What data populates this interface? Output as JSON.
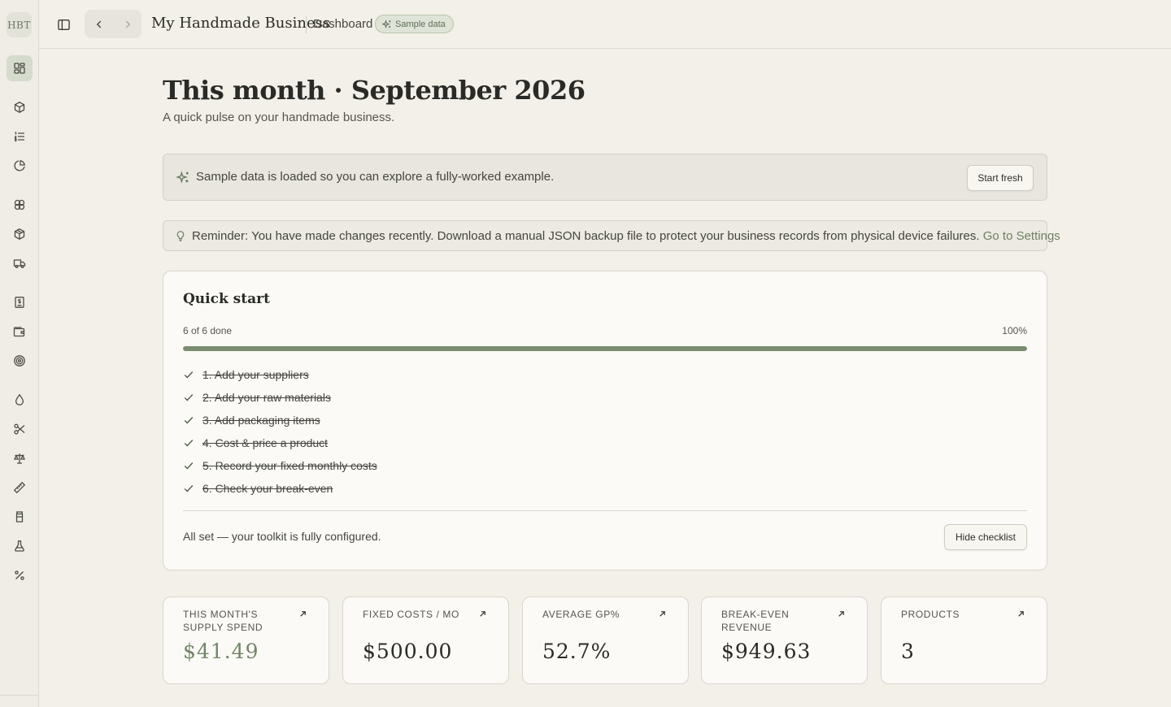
{
  "app": {
    "logo_text": "HBT",
    "business_name": "My Handmade Business",
    "breadcrumb": "Dashboard",
    "badge": "Sample data"
  },
  "sidebar": {
    "items": [
      {
        "icon": "dashboard-icon",
        "active": true
      },
      {
        "icon": "product-box-icon",
        "active": false
      },
      {
        "icon": "list-icon",
        "active": false
      },
      {
        "icon": "pie-chart-icon",
        "active": false
      },
      {
        "icon": "materials-icon",
        "active": false
      },
      {
        "icon": "packaging-box-icon",
        "active": false
      },
      {
        "icon": "truck-icon",
        "active": false
      },
      {
        "icon": "receipt-icon",
        "active": false
      },
      {
        "icon": "wallet-icon",
        "active": false
      },
      {
        "icon": "target-icon",
        "active": false
      },
      {
        "icon": "droplet-icon",
        "active": false
      },
      {
        "icon": "scissors-icon",
        "active": false
      },
      {
        "icon": "scale-icon",
        "active": false
      },
      {
        "icon": "ruler-icon",
        "active": false
      },
      {
        "icon": "jar-icon",
        "active": false
      },
      {
        "icon": "flask-icon",
        "active": false
      },
      {
        "icon": "percent-icon",
        "active": false
      }
    ]
  },
  "page": {
    "title": "This month · September 2026",
    "subtitle": "A quick pulse on your handmade business."
  },
  "sample_banner": {
    "text": "Sample data is loaded so you can explore a fully-worked example.",
    "button": "Start fresh"
  },
  "reminder": {
    "text": "Reminder: You have made changes recently. Download a manual JSON backup file to protect your business records from physical device failures.",
    "link": "Go to Settings"
  },
  "quick_start": {
    "title": "Quick start",
    "progress_label": "6 of 6 done",
    "progress_pct_label": "100%",
    "progress_fraction": 1.0,
    "steps": [
      "1. Add your suppliers",
      "2. Add your raw materials",
      "3. Add packaging items",
      "4. Cost & price a product",
      "5. Record your fixed monthly costs",
      "6. Check your break-even"
    ],
    "done_text": "All set — your toolkit is fully configured.",
    "hide_button": "Hide checklist"
  },
  "stats": [
    {
      "label": "This month's supply spend",
      "value": "$41.49",
      "accent": true
    },
    {
      "label": "Fixed costs / mo",
      "value": "$500.00",
      "accent": false
    },
    {
      "label": "Average GP%",
      "value": "52.7%",
      "accent": false
    },
    {
      "label": "Break-even revenue",
      "value": "$949.63",
      "accent": false
    },
    {
      "label": "Products",
      "value": "3",
      "accent": false
    }
  ],
  "colors": {
    "background": "#f2f0e9",
    "accent": "#7a8c6e",
    "link": "#6f8065"
  }
}
